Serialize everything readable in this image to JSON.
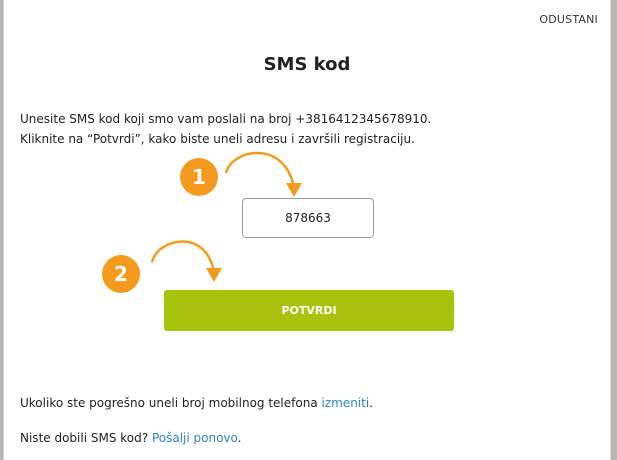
{
  "colors": {
    "accent_orange": "#f39a1f",
    "button_green": "#a8c30d",
    "link_blue": "#2f86c8",
    "text": "#222222"
  },
  "modal": {
    "cancel_label": "ODUSTANI",
    "title": "SMS kod",
    "instructions_line1": "Unesite SMS kod koji smo vam poslali na broj +3816412345678910.",
    "instructions_line2": "Kliknite na “Potvrdi”, kako biste uneli adresu i završili registraciju.",
    "step1_number": "1",
    "step2_number": "2",
    "code_value": "878663",
    "confirm_label": "POTVRDI",
    "wrong_number_text": "Ukoliko ste pogrešno uneli broj mobilnog telefona ",
    "wrong_number_link": "izmeniti",
    "wrong_number_suffix": ".",
    "resend_text": "Niste dobili SMS kod? ",
    "resend_link": "Pošalji ponovo",
    "resend_suffix": "."
  }
}
